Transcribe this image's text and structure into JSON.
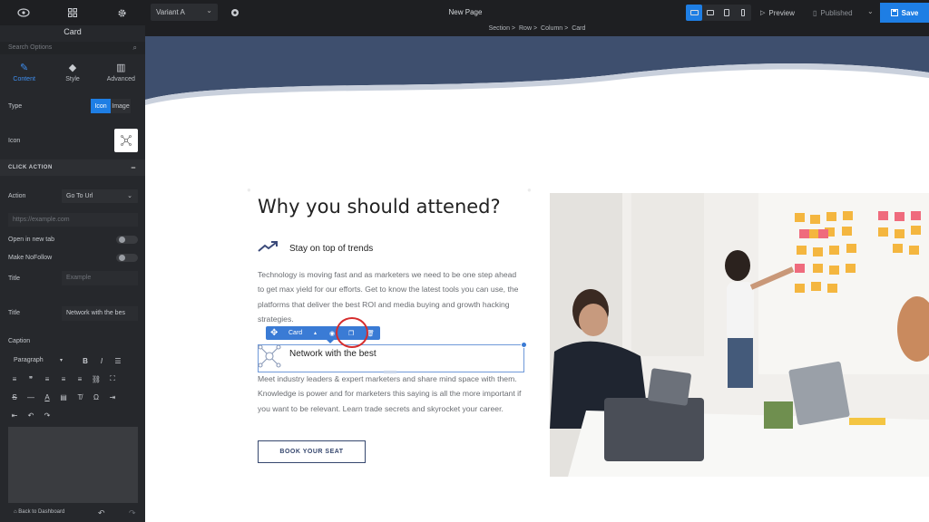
{
  "topbar": {
    "variant": "Variant A",
    "page_title": "New Page",
    "preview": "Preview",
    "published": "Published",
    "save": "Save"
  },
  "breadcrumb": [
    "Section >",
    "Row >",
    "Column >",
    "Card"
  ],
  "panel": {
    "title": "Card",
    "search_placeholder": "Search Options",
    "tabs": [
      {
        "label": "Content",
        "icon": "pen-icon",
        "active": true
      },
      {
        "label": "Style",
        "icon": "drop-icon",
        "active": false
      },
      {
        "label": "Advanced",
        "icon": "sliders-icon",
        "active": false
      }
    ],
    "type_label": "Type",
    "type_options": [
      "Icon",
      "Image"
    ],
    "icon_label": "Icon",
    "click_action_header": "CLICK ACTION",
    "action_label": "Action",
    "action_value": "Go To Url",
    "url_placeholder": "https://example.com",
    "new_tab_label": "Open in new tab",
    "nofollow_label": "Make NoFollow",
    "title1_label": "Title",
    "title1_placeholder": "Example",
    "title2_label": "Title",
    "title2_value": "Network with the bes",
    "caption_label": "Caption",
    "paragraph_select": "Paragraph",
    "back_link": "Back to Dashboard"
  },
  "canvas": {
    "heading": "Why you should attened?",
    "feature1_title": "Stay on top of trends",
    "feature1_text": "Technology is moving fast and as marketers we need to be one step ahead to get max yield for our efforts. Get to know the latest tools you can use, the platforms that deliver the best ROI and media buying and growth hacking strategies.",
    "context_label": "Card",
    "feature2_title": "Network with the best",
    "feature2_text": "Meet industry leaders & expert marketers and share mind space with them. Knowledge is power and for marketers this saying is all the more important if you want to be relevant. Learn trade secrets and skyrocket your career.",
    "cta": "BOOK YOUR SEAT"
  },
  "colors": {
    "accent": "#1e7ee4",
    "wave_dark": "#3e4f6e",
    "selection": "#3a7bd5",
    "highlight_circle": "#d62d2d",
    "button_border": "#36476e"
  }
}
